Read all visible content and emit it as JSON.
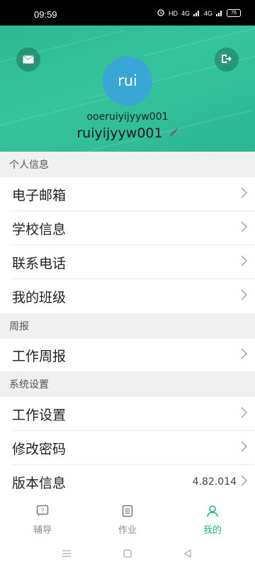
{
  "status_bar": {
    "time": "09:59",
    "network": "HD",
    "signal_1": "4G",
    "signal_2": "4G",
    "battery": "76"
  },
  "header": {
    "avatar_text": "rui",
    "account_id": "ooeruiyijyyw001",
    "display_name": "ruiyijyyw001",
    "icons": {
      "left": "mail-icon",
      "right": "logout-icon",
      "edit": "pencil-icon"
    },
    "colors": {
      "gradient_start": "#2fb992",
      "gradient_end": "#2cb693",
      "avatar_bg": "#3aa6d5"
    }
  },
  "sections": {
    "personal": {
      "title": "个人信息",
      "items": [
        {
          "label": "电子邮箱"
        },
        {
          "label": "学校信息"
        },
        {
          "label": "联系电话"
        },
        {
          "label": "我的班级"
        }
      ]
    },
    "weekly": {
      "title": "周报",
      "items": [
        {
          "label": "工作周报"
        }
      ]
    },
    "system": {
      "title": "系统设置",
      "items": [
        {
          "label": "工作设置"
        },
        {
          "label": "修改密码"
        },
        {
          "label": "版本信息",
          "value": "4.82.014"
        }
      ]
    }
  },
  "bottom_nav": {
    "active_color": "#27b486",
    "items": [
      {
        "label": "辅导",
        "icon": "tutoring-icon",
        "active": false
      },
      {
        "label": "作业",
        "icon": "homework-icon",
        "active": false
      },
      {
        "label": "我的",
        "icon": "profile-icon",
        "active": true
      }
    ]
  }
}
